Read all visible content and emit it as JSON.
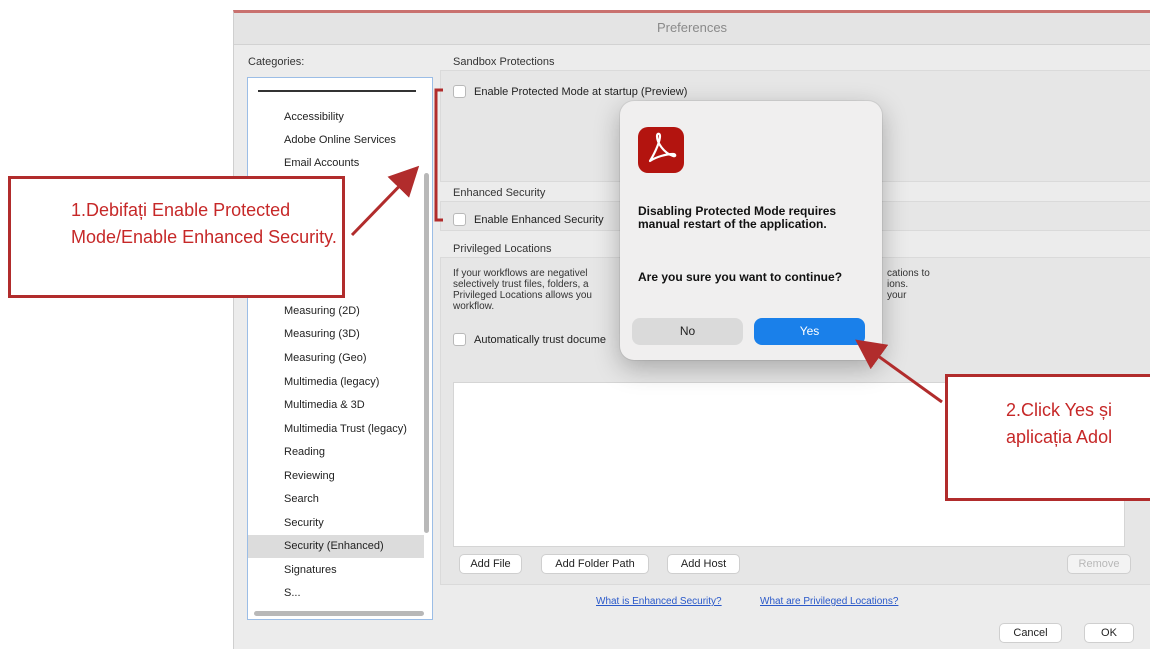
{
  "window": {
    "title": "Preferences"
  },
  "categories": {
    "label": "Categories:",
    "items": [
      "Accessibility",
      "Adobe Online Services",
      "Email Accounts",
      "Measuring (2D)",
      "Measuring (3D)",
      "Measuring (Geo)",
      "Multimedia (legacy)",
      "Multimedia & 3D",
      "Multimedia Trust (legacy)",
      "Reading",
      "Reviewing",
      "Search",
      "Security",
      "Security (Enhanced)",
      "Signatures",
      "S..."
    ],
    "selected": "Security (Enhanced)"
  },
  "sandbox": {
    "label": "Sandbox Protections",
    "protected_mode": "Enable Protected Mode at startup (Preview)"
  },
  "enhanced": {
    "label": "Enhanced Security",
    "enable": "Enable Enhanced Security"
  },
  "privileged": {
    "label": "Privileged Locations",
    "description_left": "If your workflows are negativel\nselectively trust files, folders, a\nPrivileged Locations allows you\nworkflow.",
    "description_right": "cations to\nions.\nyour",
    "auto_trust": "Automatically trust docume",
    "add_file": "Add File",
    "add_folder": "Add Folder Path",
    "add_host": "Add Host",
    "remove": "Remove"
  },
  "links": {
    "what_enhanced": "What is Enhanced Security?",
    "what_privileged": "What are Privileged Locations?"
  },
  "footer": {
    "cancel": "Cancel",
    "ok": "OK"
  },
  "dialog": {
    "title": "Disabling Protected Mode requires manual restart of the application.",
    "message": "Are you sure you want to continue?",
    "no": "No",
    "yes": "Yes"
  },
  "annotations": {
    "step1": "1.Debifați Enable Protected Mode/Enable Enhanced Security.",
    "step2": "2.Click Yes și\naplicația Adol"
  },
  "colors": {
    "annotation_red": "#b12c2c",
    "yes_blue": "#1a80ea",
    "acrobat_red": "#b3140f",
    "link_blue": "#2a59c9"
  },
  "icons": {
    "app": "adobe-acrobat-icon"
  }
}
